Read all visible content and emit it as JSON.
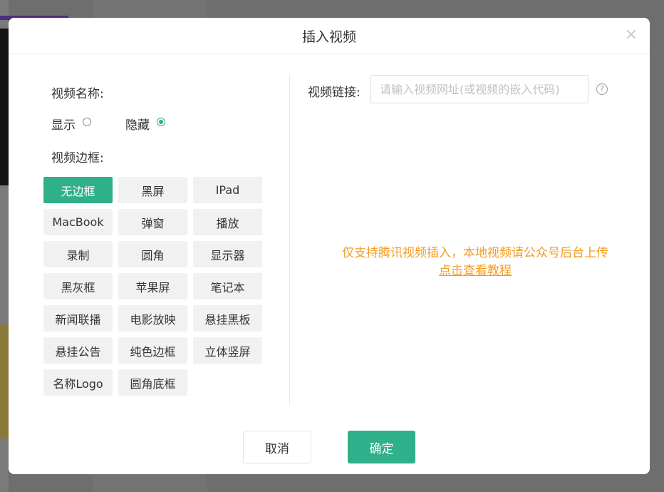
{
  "dialog": {
    "title": "插入视频",
    "close_symbol": "×"
  },
  "left": {
    "name_label": "视频名称:",
    "name_options": [
      {
        "label": "显示",
        "checked": false
      },
      {
        "label": "隐藏",
        "checked": true
      }
    ],
    "frame_label": "视频边框:",
    "frames": [
      "无边框",
      "黑屏",
      "IPad",
      "MacBook",
      "弹窗",
      "播放",
      "录制",
      "圆角",
      "显示器",
      "黑灰框",
      "苹果屏",
      "笔记本",
      "新闻联播",
      "电影放映",
      "悬挂黑板",
      "悬挂公告",
      "纯色边框",
      "立体竖屏",
      "名称Logo",
      "圆角底框"
    ],
    "selected_frame": "无边框"
  },
  "right": {
    "url_label": "视频链接:",
    "url_placeholder": "请输入视频网址(或视频的嵌入代码)",
    "url_value": "",
    "help_icon": "question-circle-icon",
    "tip_text": "仅支持腾讯视频插入，本地视频请公众号后台上传",
    "tip_link": "点击查看教程"
  },
  "footer": {
    "cancel_label": "取消",
    "confirm_label": "确定"
  },
  "colors": {
    "accent": "#2fb08a",
    "tip": "#f39c1f"
  }
}
